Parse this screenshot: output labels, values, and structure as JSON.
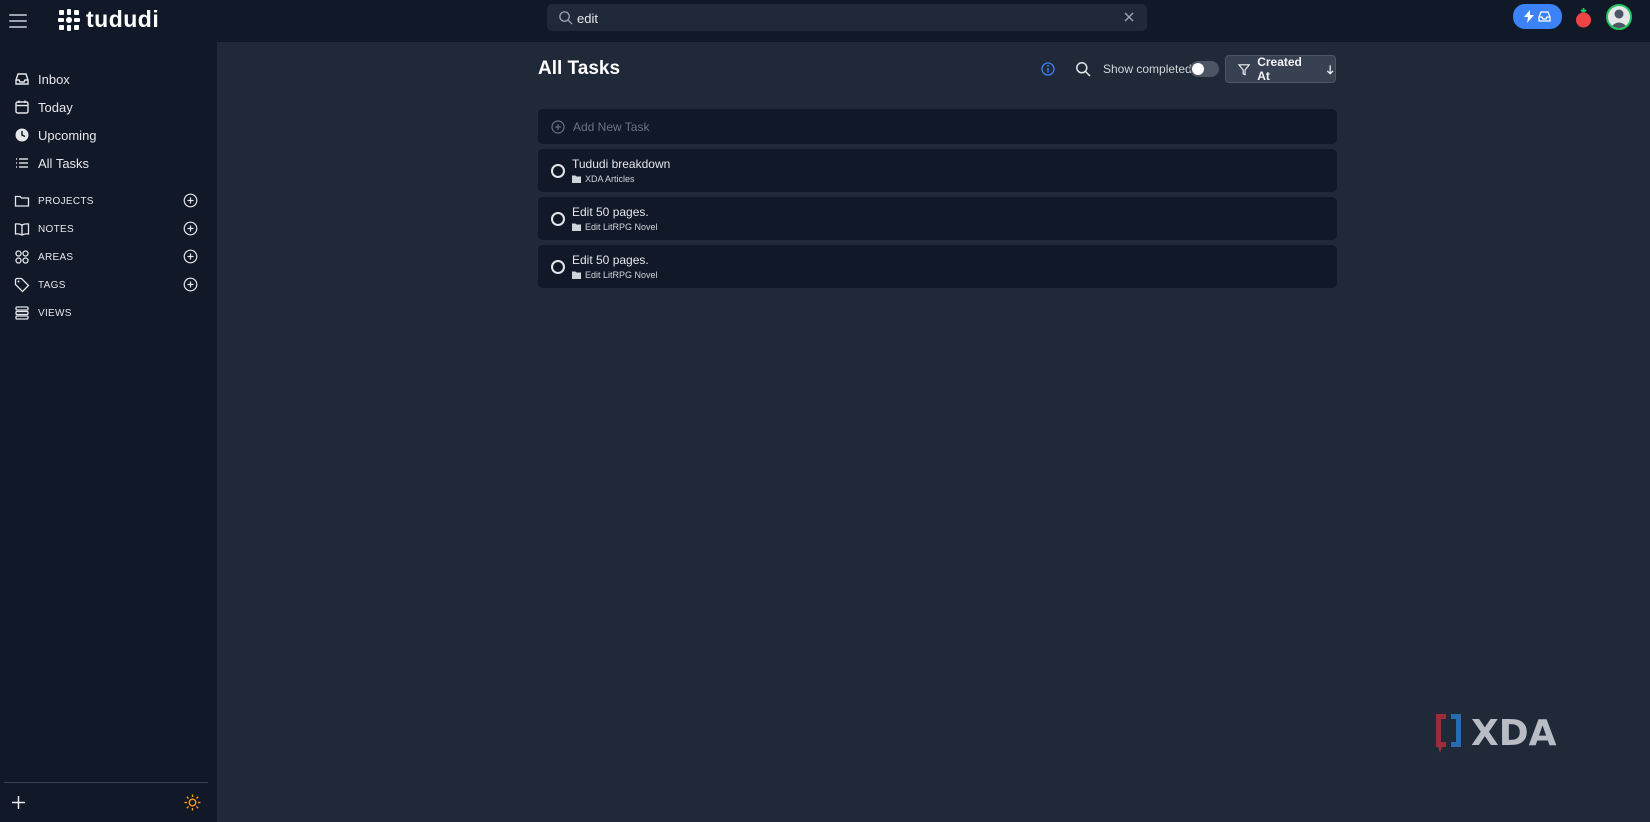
{
  "app": {
    "name": "tududi"
  },
  "search": {
    "value": "edit"
  },
  "sidebar": {
    "nav": [
      {
        "label": "Inbox",
        "icon": "inbox-icon"
      },
      {
        "label": "Today",
        "icon": "calendar-icon"
      },
      {
        "label": "Upcoming",
        "icon": "clock-icon"
      },
      {
        "label": "All Tasks",
        "icon": "list-icon"
      }
    ],
    "sections": [
      {
        "label": "PROJECTS",
        "icon": "folder-icon"
      },
      {
        "label": "NOTES",
        "icon": "book-icon"
      },
      {
        "label": "AREAS",
        "icon": "grid-icon"
      },
      {
        "label": "TAGS",
        "icon": "tag-icon"
      },
      {
        "label": "VIEWS",
        "icon": "stack-icon"
      }
    ]
  },
  "main": {
    "title": "All Tasks",
    "show_completed_label": "Show completed",
    "show_completed": false,
    "sort_label": "Created At",
    "add_task_placeholder": "Add New Task",
    "tasks": [
      {
        "name": "Tududi breakdown",
        "project": "XDA Articles"
      },
      {
        "name": "Edit 50 pages.",
        "project": "Edit LitRPG Novel"
      },
      {
        "name": "Edit 50 pages.",
        "project": "Edit LitRPG Novel"
      }
    ]
  },
  "watermark": {
    "text": "XDA"
  },
  "colors": {
    "accent": "#3b82f6",
    "background": "#1f2937",
    "panel": "#111827",
    "avatar_ring": "#22c55e",
    "sun": "#f59e0b"
  }
}
